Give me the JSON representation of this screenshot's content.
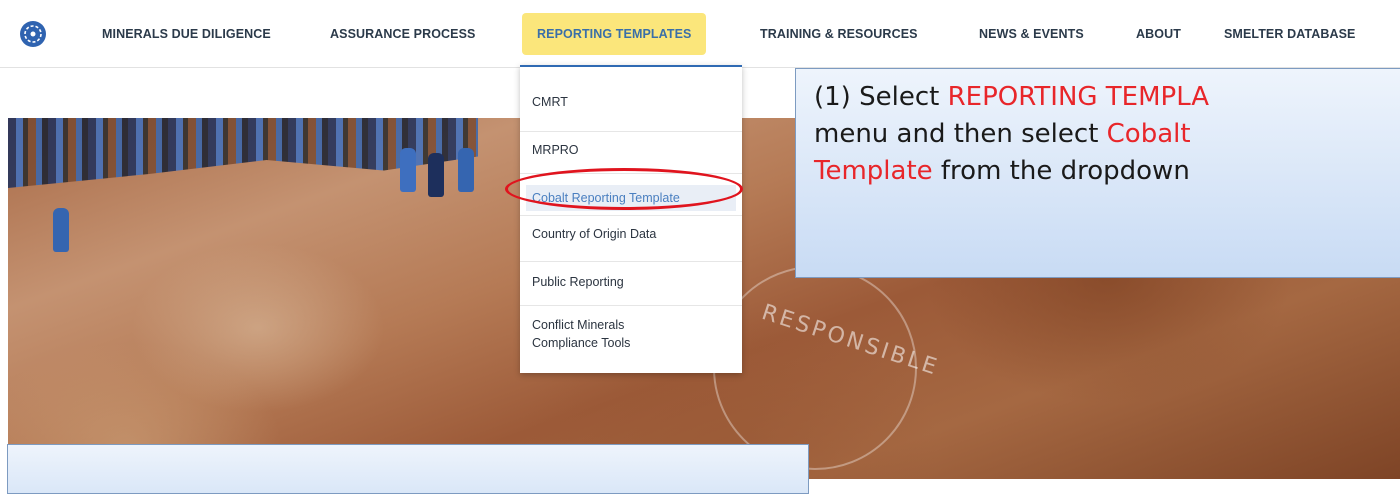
{
  "nav": {
    "items": [
      {
        "label": "MINERALS DUE DILIGENCE"
      },
      {
        "label": "ASSURANCE PROCESS"
      },
      {
        "label": "REPORTING TEMPLATES"
      },
      {
        "label": "TRAINING & RESOURCES"
      },
      {
        "label": "NEWS & EVENTS"
      },
      {
        "label": "ABOUT"
      },
      {
        "label": "SMELTER DATABASE"
      }
    ],
    "active_label": "REPORTING TEMPLATES",
    "logo_icon": "globe-logo-icon"
  },
  "dropdown": {
    "items": [
      {
        "label": "CMRT"
      },
      {
        "label": "MRPRO"
      },
      {
        "label": "Cobalt Reporting Template"
      },
      {
        "label": "Country of Origin Data"
      },
      {
        "label": "Public Reporting"
      },
      {
        "label": "Conflict Minerals"
      },
      {
        "label": "Compliance Tools"
      }
    ],
    "highlighted": "Cobalt Reporting Template"
  },
  "hero": {
    "emblem_text": "RESPONSIBLE"
  },
  "callout": {
    "line1_prefix": "(1) Select ",
    "line1_red": "REPORTING TEMPLA",
    "line2_prefix": "menu and then select  ",
    "line2_red": "Cobalt",
    "line3_red": "Template",
    "line3_suffix": " from the dropdown"
  },
  "colors": {
    "accent_yellow": "#fbe67b",
    "link_blue": "#3a6fa8",
    "annotation_red": "#e0141e",
    "callout_text_red": "#e8262a"
  }
}
